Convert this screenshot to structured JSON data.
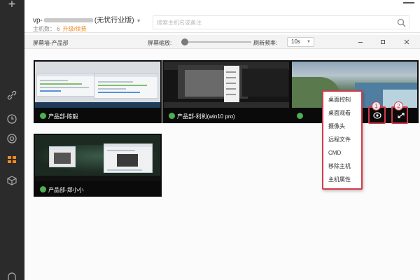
{
  "app": {
    "host_name_prefix": "vp-",
    "host_name_suffix": "(无忧行业版)",
    "host_count_label": "主机数：",
    "host_count": "6",
    "upgrade_link": "升级/续费",
    "search_placeholder": "搜索主机名或备注"
  },
  "toolbar": {
    "title": "屏幕墙-产品部",
    "zoom_label": "屏幕缩放:",
    "zoom_level": 0,
    "refresh_label": "刷新频率:",
    "refresh_value": "10s"
  },
  "tiles": [
    {
      "label": "产品部-陈毅",
      "online": true
    },
    {
      "label": "产品部-利利(win10 pro)",
      "online": true
    },
    {
      "label": "产品部-郑小小",
      "online": true
    }
  ],
  "context_menu": {
    "items": [
      "桌面控制",
      "桌面观看",
      "摄像头",
      "远程文件",
      "CMD",
      "移除主机",
      "主机属性"
    ]
  },
  "annotations": {
    "badge_1": "1",
    "badge_2": "2"
  },
  "colors": {
    "online": "#4caf50",
    "highlight": "#d23a4a",
    "upgrade": "#f08a24",
    "rail": "#2b2b2b"
  }
}
